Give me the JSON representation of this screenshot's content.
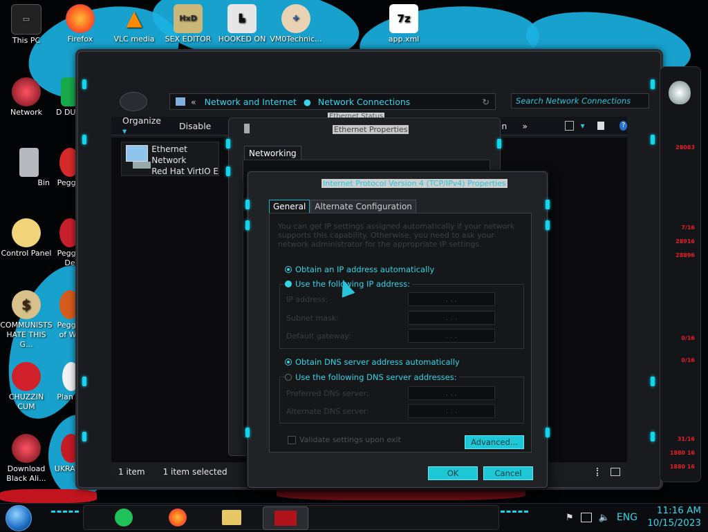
{
  "desktop": {
    "icons": [
      {
        "label": "This PC",
        "icon": "this-pc-icon"
      },
      {
        "label": "Firefox",
        "icon": "firefox-icon"
      },
      {
        "label": "VLC media",
        "icon": "vlc-icon"
      },
      {
        "label": "SEX EDITOR",
        "icon": "hxd-icon"
      },
      {
        "label": "HOOKED ON",
        "icon": "hooked-on-icon"
      },
      {
        "label": "VM0Technic...",
        "icon": "doctor-icon"
      },
      {
        "label": "app.xml",
        "icon": "7zip-icon"
      },
      {
        "label": "Network",
        "icon": "network-icon"
      },
      {
        "label": "D DUM",
        "icon": "green-app-icon"
      },
      {
        "label": "Bin",
        "icon": "recycle-bin-icon"
      },
      {
        "label": "Peggle",
        "icon": "peggle-icon"
      },
      {
        "label": "Control Panel",
        "icon": "control-panel-icon"
      },
      {
        "label": "Peggle De",
        "icon": "peggle-deluxe-icon"
      },
      {
        "label": "COMMUNISTS HATE THIS G...",
        "icon": "money-bag-icon"
      },
      {
        "label": "Peggle of Wa",
        "icon": "peggle-wa-icon"
      },
      {
        "label": "CHUZZIN CUM",
        "icon": "chuzzle-icon"
      },
      {
        "label": "Plan Zo",
        "icon": "plants-zombies-icon"
      },
      {
        "label": "Download Black Ali...",
        "icon": "alienware-icon"
      },
      {
        "label": "UKRAINE",
        "icon": "ukraine-icon"
      }
    ]
  },
  "explorer": {
    "breadcrumb": {
      "back": "«",
      "part1": "Network and Internet",
      "part2": "Network Connections"
    },
    "search_placeholder": "Search Network Connections",
    "toolbar": {
      "organize": "Organize",
      "disable": "Disable",
      "more": "»",
      "partial": "n"
    },
    "item": {
      "line1": "Ethernet",
      "line2": "Network",
      "line3": "Red Hat VirtIO E"
    },
    "status": {
      "count": "1 item",
      "selected": "1 item selected"
    },
    "hidden_title": "Ethernet Status"
  },
  "ethernet_properties": {
    "title": "Ethernet Properties",
    "tab": "Networking"
  },
  "ipv4": {
    "title": "Internet Protocol Version 4 (TCP/IPv4) Properties",
    "tabs": {
      "general": "General",
      "alternate": "Alternate Configuration"
    },
    "intro": "You can get IP settings assigned automatically if your network supports this capability. Otherwise, you need to ask your network administrator for the appropriate IP settings.",
    "ip_auto": "Obtain an IP address automatically",
    "ip_manual": "Use the following IP address:",
    "ip_fields": {
      "ip": "IP address:",
      "mask": "Subnet mask:",
      "gateway": "Default gateway:"
    },
    "dns_auto": "Obtain DNS server address automatically",
    "dns_manual": "Use the following DNS server addresses:",
    "dns_fields": {
      "preferred": "Preferred DNS server:",
      "alternate": "Alternate DNS server:"
    },
    "ip_dots": ". . .",
    "validate": "Validate settings upon exit",
    "advanced": "Advanced...",
    "ok": "OK",
    "cancel": "Cancel"
  },
  "gadget": {
    "readings": [
      "28083",
      "7/16",
      "28916",
      "28896",
      "0/16",
      "0/16",
      "31/16",
      "1880 16",
      "1880 16"
    ]
  },
  "taskbar": {
    "language": "ENG",
    "time": "11:16 AM",
    "date": "10/15/2023"
  },
  "colors": {
    "accent": "#1ec7d6",
    "wallpaper_splash": "#1bb3e3",
    "alert_red": "#e0202a"
  }
}
